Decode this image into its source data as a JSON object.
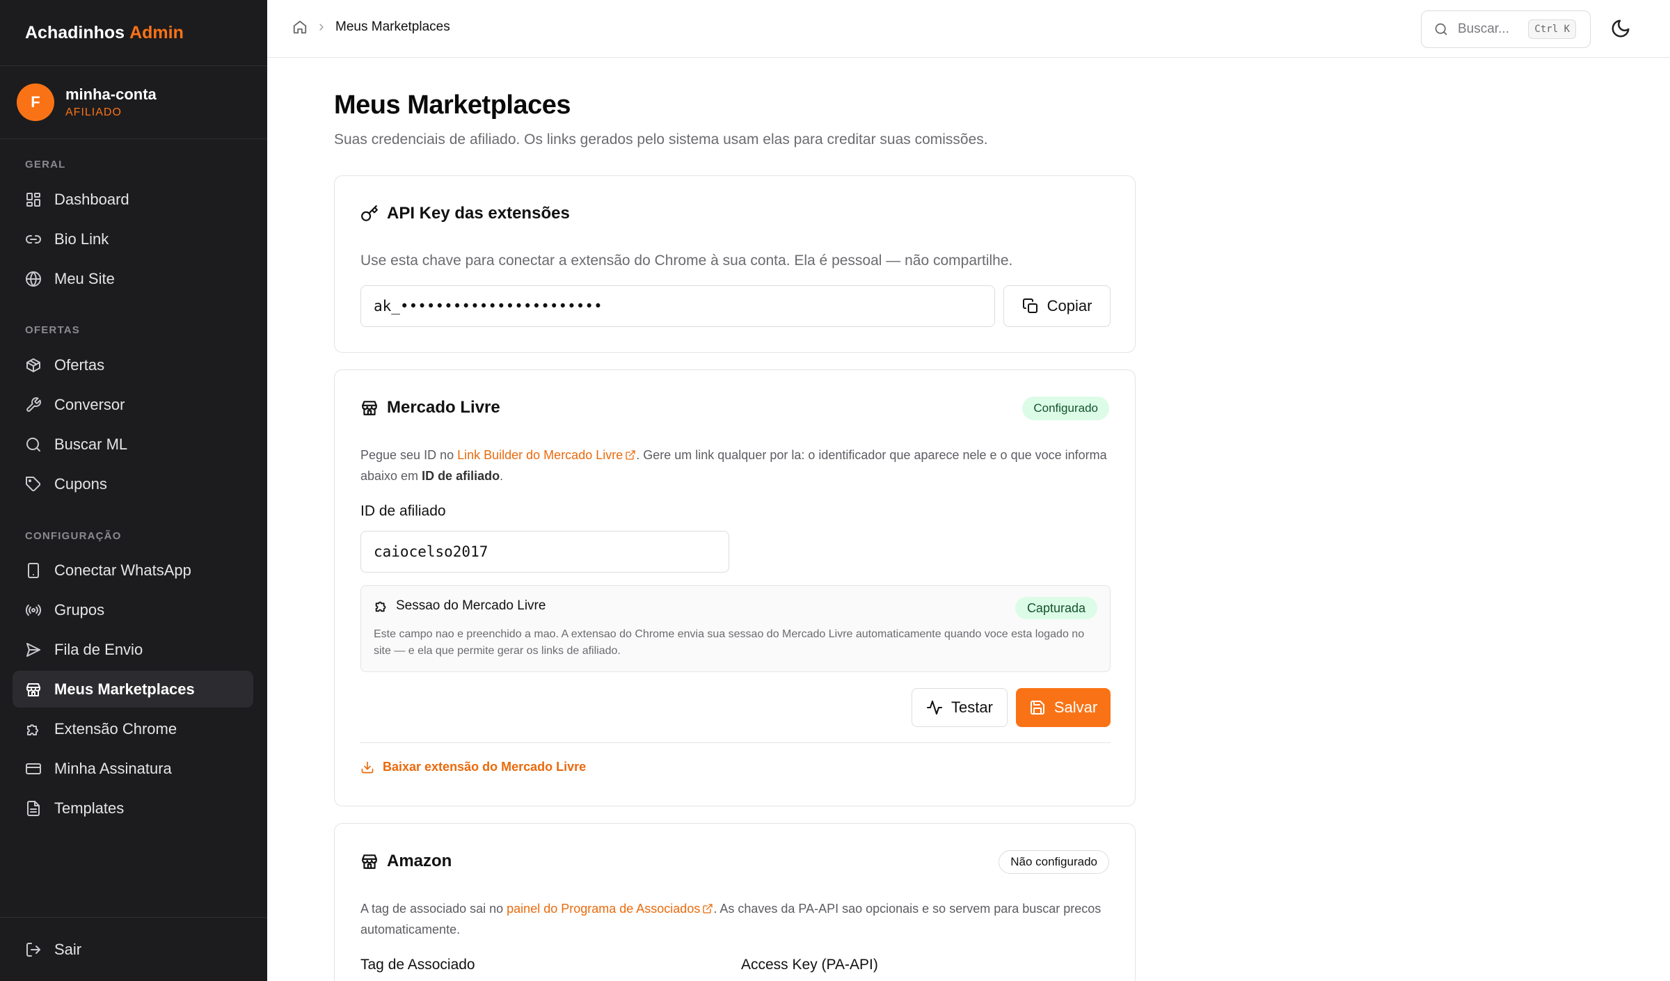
{
  "brand": {
    "name": "Achadinhos",
    "accent": "Admin"
  },
  "account": {
    "initial": "F",
    "name": "minha-conta",
    "role": "AFILIADO"
  },
  "sidebar": {
    "sections": [
      {
        "label": "GERAL"
      },
      {
        "label": "OFERTAS"
      },
      {
        "label": "CONFIGURAÇÃO"
      }
    ],
    "items": [
      {
        "label": "Dashboard",
        "icon": "dashboard-icon"
      },
      {
        "label": "Bio Link",
        "icon": "link-icon"
      },
      {
        "label": "Meu Site",
        "icon": "globe-icon"
      },
      {
        "label": "Ofertas",
        "icon": "package-icon"
      },
      {
        "label": "Conversor",
        "icon": "wrench-icon"
      },
      {
        "label": "Buscar ML",
        "icon": "search-icon"
      },
      {
        "label": "Cupons",
        "icon": "tag-icon"
      },
      {
        "label": "Conectar WhatsApp",
        "icon": "smartphone-icon"
      },
      {
        "label": "Grupos",
        "icon": "broadcast-icon"
      },
      {
        "label": "Fila de Envio",
        "icon": "send-icon"
      },
      {
        "label": "Meus Marketplaces",
        "icon": "store-icon",
        "active": true
      },
      {
        "label": "Extensão Chrome",
        "icon": "puzzle-icon"
      },
      {
        "label": "Minha Assinatura",
        "icon": "credit-card-icon"
      },
      {
        "label": "Templates",
        "icon": "file-text-icon"
      }
    ],
    "logout": "Sair"
  },
  "topbar": {
    "breadcrumb": "Meus Marketplaces",
    "search_placeholder": "Buscar...",
    "shortcut": "Ctrl K"
  },
  "page": {
    "title": "Meus Marketplaces",
    "subtitle": "Suas credenciais de afiliado. Os links gerados pelo sistema usam elas para creditar suas comissões."
  },
  "api_key_card": {
    "title": "API Key das extensões",
    "description": "Use esta chave para conectar a extensão do Chrome à sua conta. Ela é pessoal — não compartilhe.",
    "value": "ak_•••••••••••••••••••••••",
    "copy_label": "Copiar"
  },
  "mercado_livre": {
    "title": "Mercado Livre",
    "status": "Configurado",
    "desc_pre": "Pegue seu ID no ",
    "desc_link": "Link Builder do Mercado Livre",
    "desc_mid": ". Gere um link qualquer por la: o identificador que aparece nele e o que voce informa abaixo em ",
    "desc_bold": "ID de afiliado",
    "desc_end": ".",
    "field_label": "ID de afiliado",
    "field_value": "caiocelso2017",
    "session_title": "Sessao do Mercado Livre",
    "session_status": "Capturada",
    "session_text": "Este campo nao e preenchido a mao. A extensao do Chrome envia sua sessao do Mercado Livre automaticamente quando voce esta logado no site — e ela que permite gerar os links de afiliado.",
    "test_label": "Testar",
    "save_label": "Salvar",
    "download_label": "Baixar extensão do Mercado Livre"
  },
  "amazon": {
    "title": "Amazon",
    "status": "Não configurado",
    "desc_pre": "A tag de associado sai no ",
    "desc_link": "painel do Programa de Associados",
    "desc_end": ". As chaves da PA-API sao opcionais e so servem para buscar precos automaticamente.",
    "tag_label": "Tag de Associado",
    "access_key_label": "Access Key (PA-API)"
  },
  "colors": {
    "accent": "#f97316",
    "sidebar_bg": "#1c1c1e",
    "success_bg": "#dcfce7",
    "success_text": "#14532d"
  }
}
